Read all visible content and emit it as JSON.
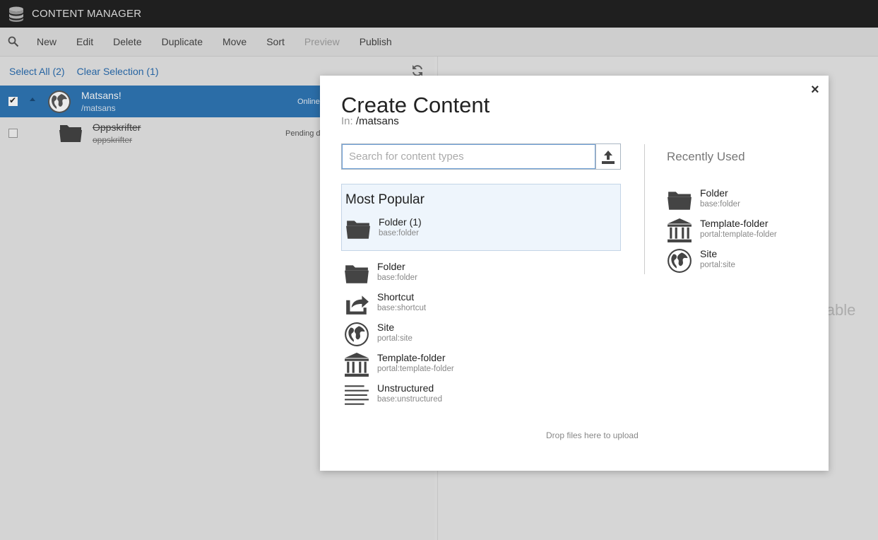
{
  "app": {
    "title": "CONTENT MANAGER",
    "logo_icon": "database-icon"
  },
  "toolbar": {
    "search_icon": "search-icon",
    "buttons": [
      {
        "label": "New",
        "enabled": true
      },
      {
        "label": "Edit",
        "enabled": true
      },
      {
        "label": "Delete",
        "enabled": true
      },
      {
        "label": "Duplicate",
        "enabled": true
      },
      {
        "label": "Move",
        "enabled": true
      },
      {
        "label": "Sort",
        "enabled": true
      },
      {
        "label": "Preview",
        "enabled": false
      },
      {
        "label": "Publish",
        "enabled": true
      }
    ]
  },
  "selection": {
    "select_all": "Select All (2)",
    "clear_selection": "Clear Selection (1)"
  },
  "tree": [
    {
      "name": "Matsans!",
      "path": "/matsans",
      "status": "Online",
      "checked": true,
      "icon": "globe-icon"
    },
    {
      "name": "Oppskrifter",
      "path": "oppskrifter",
      "status": "Pending d",
      "checked": false,
      "icon": "folder-icon",
      "strikethrough": true
    }
  ],
  "right_panel": {
    "text": "ilable"
  },
  "modal": {
    "title": "Create Content",
    "in_label": "In:",
    "in_path": "/matsans",
    "search_placeholder": "Search for content types",
    "search_value": "",
    "most_popular_title": "Most Popular",
    "most_popular": [
      {
        "name": "Folder (1)",
        "key": "base:folder",
        "icon": "folder-icon"
      }
    ],
    "all_types": [
      {
        "name": "Folder",
        "key": "base:folder",
        "icon": "folder-icon"
      },
      {
        "name": "Shortcut",
        "key": "base:shortcut",
        "icon": "shortcut-icon"
      },
      {
        "name": "Site",
        "key": "portal:site",
        "icon": "globe-icon"
      },
      {
        "name": "Template-folder",
        "key": "portal:template-folder",
        "icon": "template-folder-icon"
      },
      {
        "name": "Unstructured",
        "key": "base:unstructured",
        "icon": "unstructured-icon"
      }
    ],
    "recently_used_title": "Recently Used",
    "recently_used": [
      {
        "name": "Folder",
        "key": "base:folder",
        "icon": "folder-icon"
      },
      {
        "name": "Template-folder",
        "key": "portal:template-folder",
        "icon": "template-folder-icon"
      },
      {
        "name": "Site",
        "key": "portal:site",
        "icon": "globe-icon"
      }
    ],
    "drop_text": "Drop files here to upload",
    "close_glyph": "×"
  }
}
